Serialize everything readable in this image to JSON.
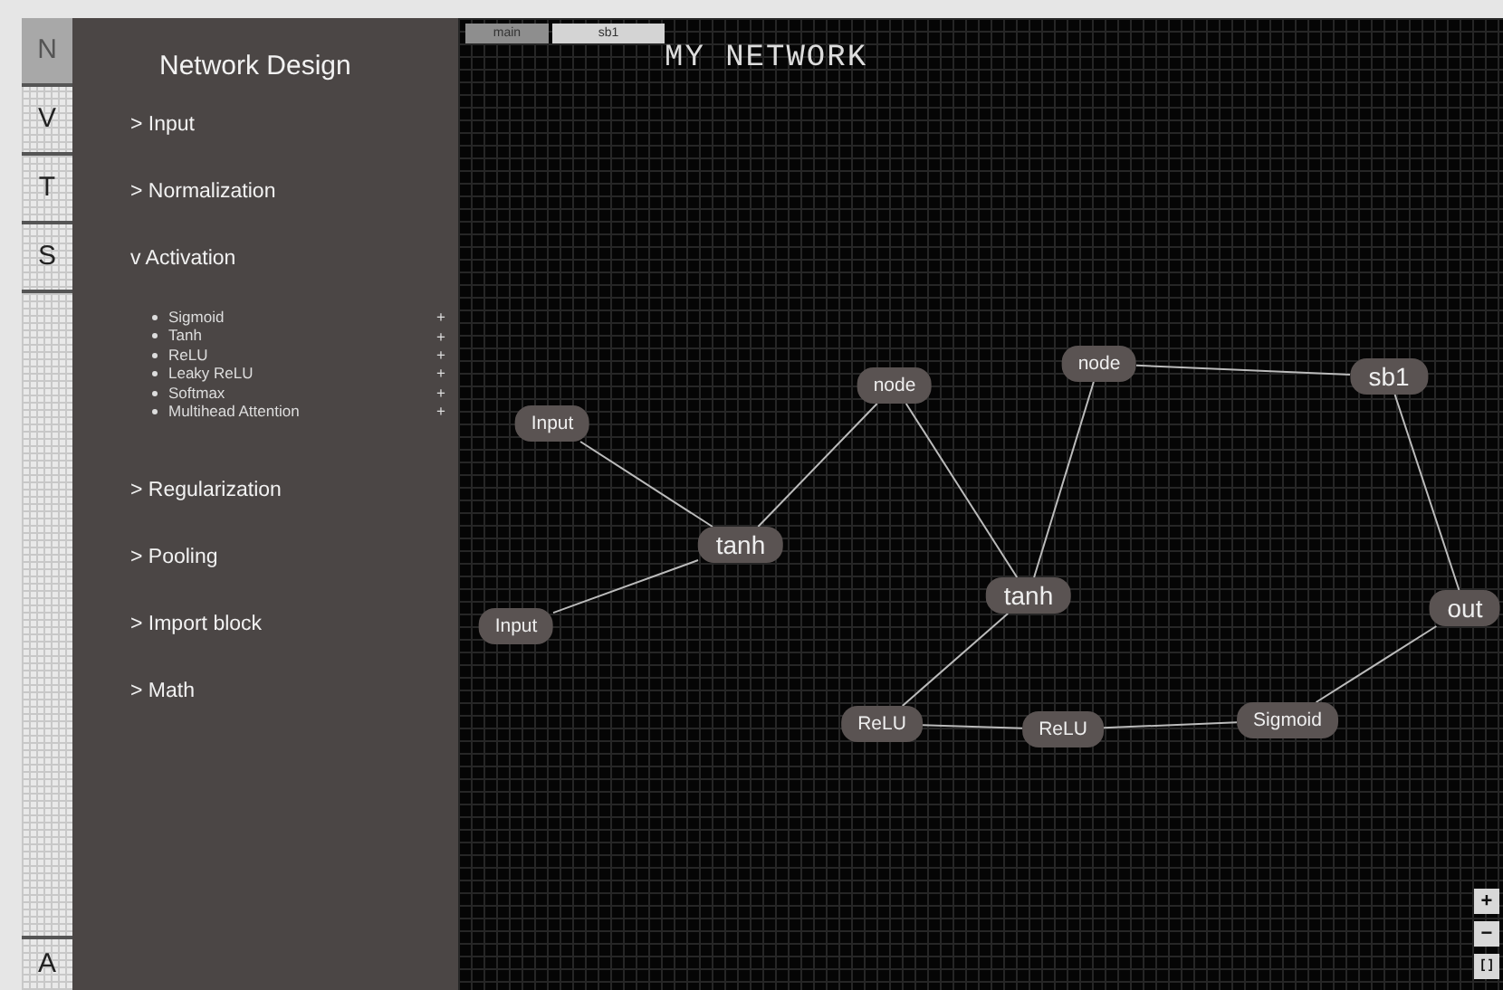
{
  "rail": {
    "tabs": [
      {
        "label": "N",
        "selected": true
      },
      {
        "label": "V",
        "selected": false
      },
      {
        "label": "T",
        "selected": false
      },
      {
        "label": "S",
        "selected": false
      }
    ],
    "bottom_tab": {
      "label": "A",
      "selected": false
    }
  },
  "sidebar": {
    "title": "Network Design",
    "sections": [
      {
        "marker": ">",
        "label": "Input"
      },
      {
        "marker": ">",
        "label": "Normalization"
      },
      {
        "marker": "v",
        "label": "Activation",
        "items": [
          {
            "label": "Sigmoid",
            "action": "+"
          },
          {
            "label": "Tanh",
            "action": "+"
          },
          {
            "label": "ReLU",
            "action": "+"
          },
          {
            "label": "Leaky ReLU",
            "action": "+"
          },
          {
            "label": "Softmax",
            "action": "+"
          },
          {
            "label": "Multihead Attention",
            "action": "+"
          }
        ]
      },
      {
        "marker": ">",
        "label": "Regularization"
      },
      {
        "marker": ">",
        "label": "Pooling"
      },
      {
        "marker": ">",
        "label": "Import block"
      },
      {
        "marker": ">",
        "label": "Math"
      }
    ]
  },
  "canvas": {
    "tabs": [
      {
        "label": "main",
        "selected": true
      },
      {
        "label": "sb1",
        "selected": false
      }
    ],
    "title": "MY NETWORK",
    "nodes": [
      {
        "label": "Input",
        "kind": "layer"
      },
      {
        "label": "tanh",
        "kind": "block"
      },
      {
        "label": "Input",
        "kind": "layer"
      },
      {
        "label": "node",
        "kind": "layer"
      },
      {
        "label": "node",
        "kind": "layer"
      },
      {
        "label": "tanh",
        "kind": "block"
      },
      {
        "label": "sb1",
        "kind": "block"
      },
      {
        "label": "out",
        "kind": "block"
      },
      {
        "label": "ReLU",
        "kind": "layer"
      },
      {
        "label": "ReLU",
        "kind": "layer"
      },
      {
        "label": "Sigmoid",
        "kind": "layer"
      }
    ],
    "zoom_controls": [
      "+",
      "−",
      "[ ]"
    ]
  }
}
